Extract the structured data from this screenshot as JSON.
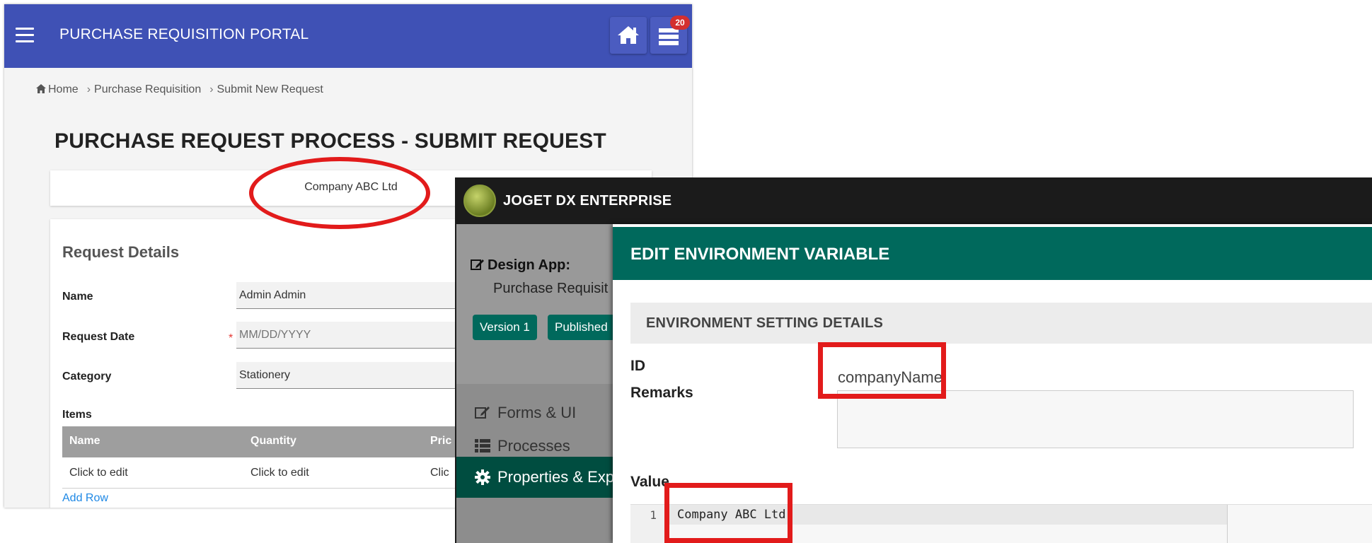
{
  "portal": {
    "title": "PURCHASE REQUISITION PORTAL",
    "badge_count": "20",
    "breadcrumb": {
      "home": "Home",
      "level2": "Purchase Requisition",
      "level3": "Submit New Request",
      "separator": "›"
    },
    "page_title": "PURCHASE REQUEST PROCESS - SUBMIT REQUEST",
    "company_name": "Company ABC Ltd",
    "request_details": {
      "title": "Request Details",
      "name_label": "Name",
      "name_value": "Admin Admin",
      "date_label": "Request Date",
      "date_placeholder": "MM/DD/YYYY",
      "required_mark": "*",
      "category_label": "Category",
      "category_value": "Stationery",
      "items_label": "Items",
      "items_columns": [
        "Name",
        "Quantity",
        "Pric"
      ],
      "items_row": [
        "Click to edit",
        "Click to edit",
        "Clic"
      ],
      "add_row": "Add Row"
    },
    "colors": {
      "header": "#3f51b5",
      "annotation": "#e21b1b"
    }
  },
  "joget": {
    "title": "JOGET DX ENTERPRISE",
    "sidebar": {
      "design_label": "Design App:",
      "app_name": "Purchase Requisit",
      "version": "Version 1",
      "published": "Published",
      "menu": [
        {
          "label": "Forms & UI",
          "icon": "edit-icon"
        },
        {
          "label": "Processes",
          "icon": "list-icon"
        },
        {
          "label": "Properties & Expo",
          "icon": "gear-icon"
        }
      ]
    },
    "modal": {
      "title": "EDIT ENVIRONMENT VARIABLE",
      "section_title": "ENVIRONMENT SETTING DETAILS",
      "id_label": "ID",
      "id_value": "companyName",
      "remarks_label": "Remarks",
      "value_label": "Value",
      "line_number": "1",
      "code_value": "Company ABC Ltd"
    },
    "colors": {
      "teal": "#00695c",
      "active": "#004d40"
    }
  }
}
